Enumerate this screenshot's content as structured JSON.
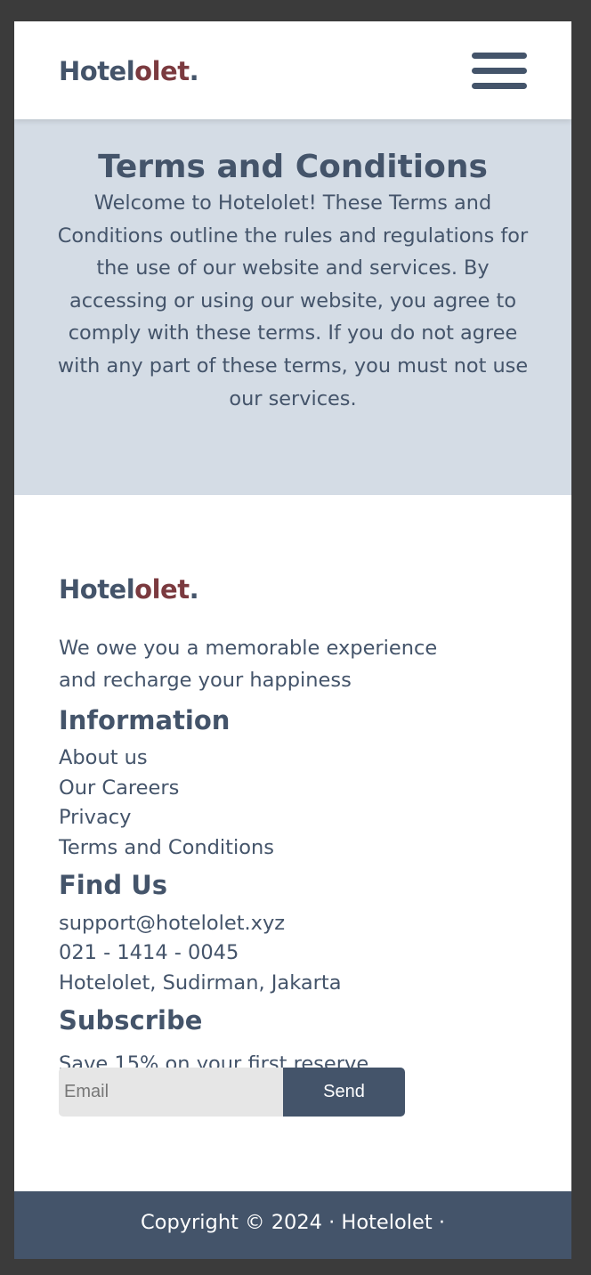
{
  "brand": {
    "name_primary": "Hotel",
    "name_accent": "olet",
    "name_dot": ".",
    "colors": {
      "primary": "#44546a",
      "accent": "#7b3a3f",
      "hero_bg": "#d4dce5",
      "input_bg": "#e6e6e6"
    }
  },
  "header": {
    "menu_icon": "hamburger-menu-icon"
  },
  "hero": {
    "title": "Terms and Conditions",
    "text": "Welcome to Hotelolet! These Terms and Conditions outline the rules and regulations for the use of our website and services. By accessing or using our website, you agree to comply with these terms. If you do not agree with any part of these terms, you must not use our services."
  },
  "footer": {
    "tagline": "We owe you a memorable experience and recharge your happiness",
    "information": {
      "title": "Information",
      "links": [
        "About us",
        "Our Careers",
        "Privacy",
        "Terms and Conditions"
      ]
    },
    "find_us": {
      "title": "Find Us",
      "email": "support@hotelolet.xyz",
      "phone": "021 - 1414 - 0045",
      "address": "Hotelolet, Sudirman, Jakarta"
    },
    "subscribe": {
      "title": "Subscribe",
      "text": "Save 15% on your first reserve",
      "email_placeholder": "Email",
      "email_value": "",
      "send_label": "Send"
    },
    "copyright": "Copyright © 2024 · Hotelolet ·"
  }
}
